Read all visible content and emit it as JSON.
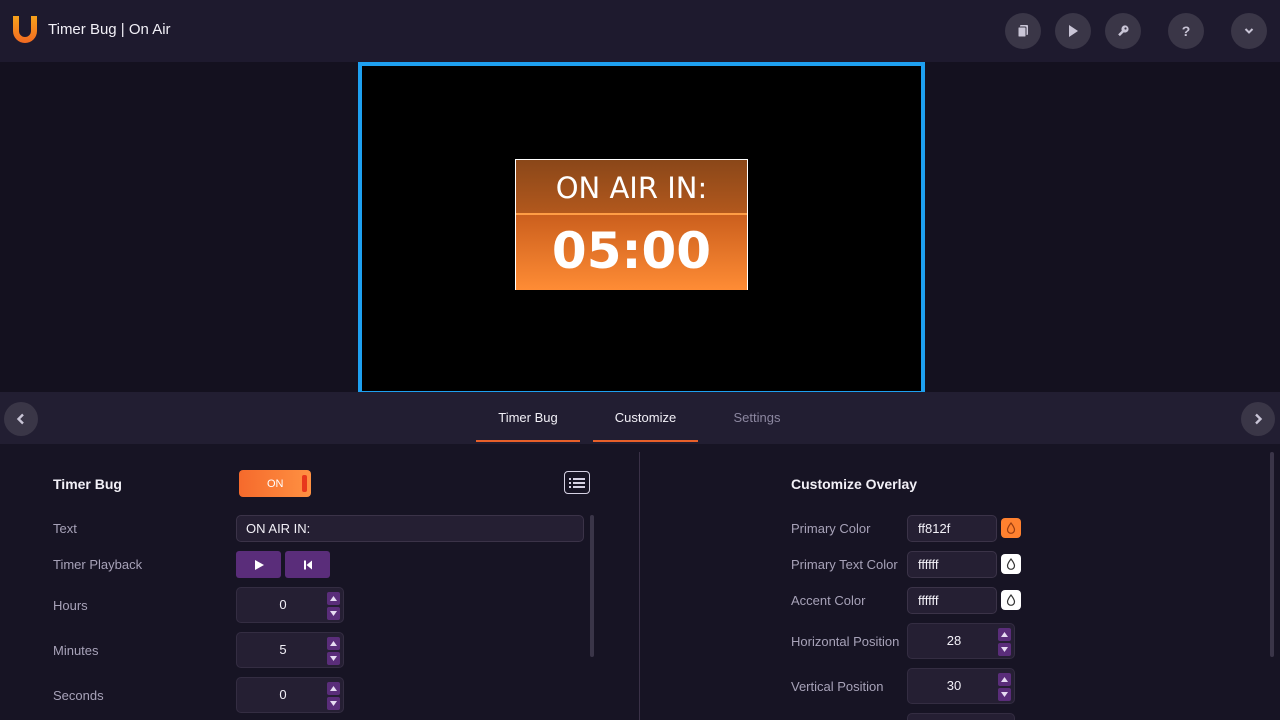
{
  "header": {
    "app_title": "Timer Bug | On Air",
    "buttons": [
      "copy-icon",
      "play-icon",
      "key-icon",
      "help-icon",
      "chevron-down-icon"
    ],
    "help_glyph": "?"
  },
  "preview": {
    "bug_label": "ON AIR IN:",
    "bug_time": "05:00",
    "colors": {
      "frame": "#1ea0f0",
      "primary": "#ff812f"
    }
  },
  "tabs": [
    {
      "label": "Timer Bug",
      "active": true
    },
    {
      "label": "Customize",
      "active": true
    },
    {
      "label": "Settings",
      "active": false
    }
  ],
  "timer_panel": {
    "title": "Timer Bug",
    "toggle_label": "ON",
    "text_label": "Text",
    "text_value": "ON AIR IN:",
    "playback_label": "Timer Playback",
    "hours_label": "Hours",
    "hours_value": "0",
    "minutes_label": "Minutes",
    "minutes_value": "5",
    "seconds_label": "Seconds",
    "seconds_value": "0"
  },
  "customize_panel": {
    "title": "Customize Overlay",
    "primary_color_label": "Primary Color",
    "primary_color_value": "ff812f",
    "primary_text_color_label": "Primary Text Color",
    "primary_text_color_value": "ffffff",
    "accent_color_label": "Accent Color",
    "accent_color_value": "ffffff",
    "horizontal_position_label": "Horizontal Position",
    "horizontal_position_value": "28",
    "vertical_position_label": "Vertical Position",
    "vertical_position_value": "30"
  }
}
